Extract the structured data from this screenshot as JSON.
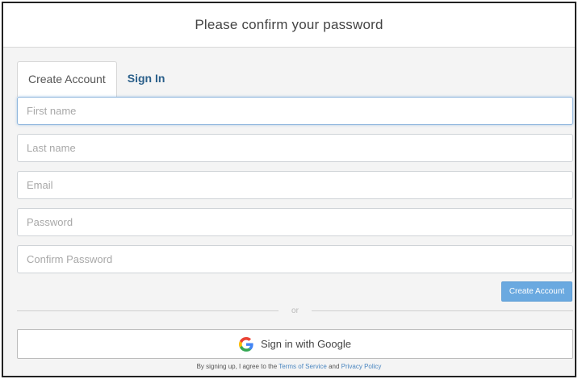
{
  "header": {
    "title": "Please confirm your password"
  },
  "tabs": [
    {
      "label": "Create Account",
      "active": true
    },
    {
      "label": "Sign In",
      "active": false
    }
  ],
  "form": {
    "first_name": {
      "placeholder": "First name",
      "value": ""
    },
    "last_name": {
      "placeholder": "Last name",
      "value": ""
    },
    "email": {
      "placeholder": "Email",
      "value": ""
    },
    "password": {
      "placeholder": "Password",
      "value": ""
    },
    "confirm_password": {
      "placeholder": "Confirm Password",
      "value": ""
    },
    "submit_label": "Create Account"
  },
  "divider": {
    "text": "or"
  },
  "google": {
    "label": "Sign in with Google",
    "icon": "google-icon"
  },
  "legal": {
    "prefix": "By signing up, I agree to the ",
    "terms": "Terms of Service",
    "and": " and ",
    "privacy": "Privacy Policy"
  },
  "colors": {
    "primary": "#6aa9e0",
    "link": "#2a5f8a",
    "background": "#f4f4f4"
  }
}
